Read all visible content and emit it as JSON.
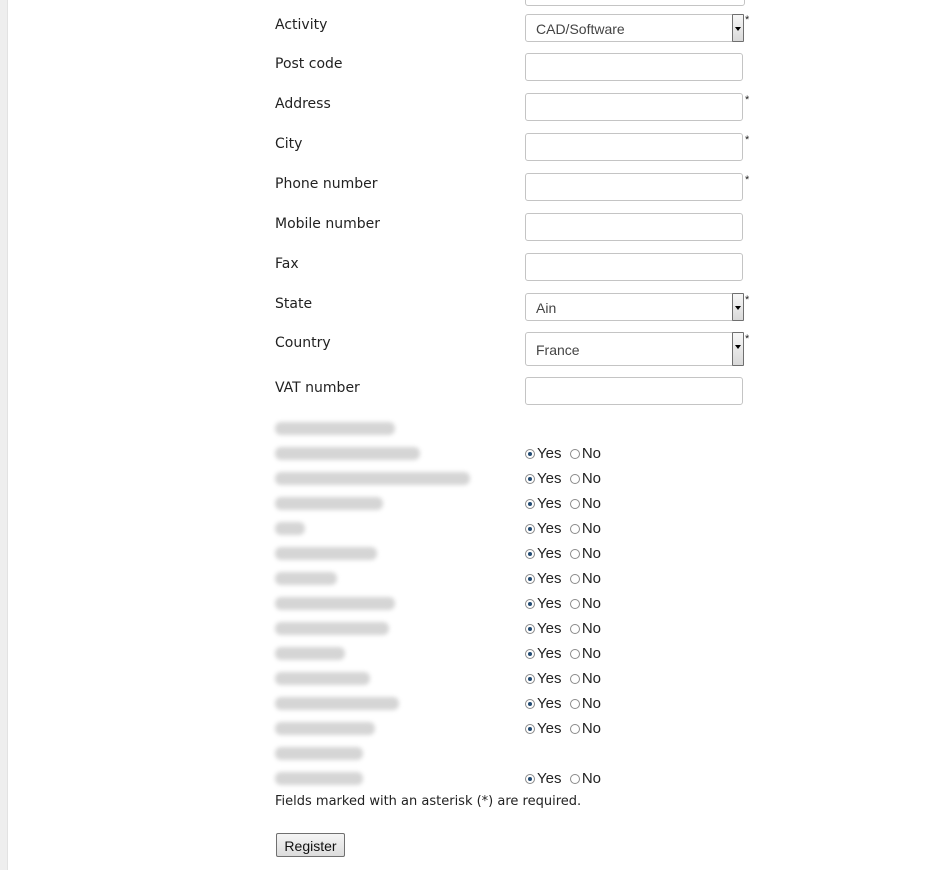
{
  "form": {
    "fields": {
      "activity": {
        "label": "Activity",
        "value": "CAD/Software",
        "required": "*"
      },
      "postcode": {
        "label": "Post code",
        "value": ""
      },
      "address": {
        "label": "Address",
        "value": "",
        "required": "*"
      },
      "city": {
        "label": "City",
        "value": "",
        "required": "*"
      },
      "phone": {
        "label": "Phone number",
        "value": "",
        "required": "*"
      },
      "mobile": {
        "label": "Mobile number",
        "value": ""
      },
      "fax": {
        "label": "Fax",
        "value": ""
      },
      "state": {
        "label": "State",
        "value": "Ain",
        "required": "*"
      },
      "country": {
        "label": "Country",
        "value": "France",
        "required": "*"
      },
      "vat": {
        "label": "VAT number",
        "value": ""
      }
    },
    "options": {
      "yes": "Yes",
      "no": "No"
    },
    "required_note": "Fields marked with an asterisk (*) are required.",
    "register_label": "Register"
  },
  "colors": {
    "radio_checked": "#234b73",
    "border": "#c4c4c4"
  }
}
